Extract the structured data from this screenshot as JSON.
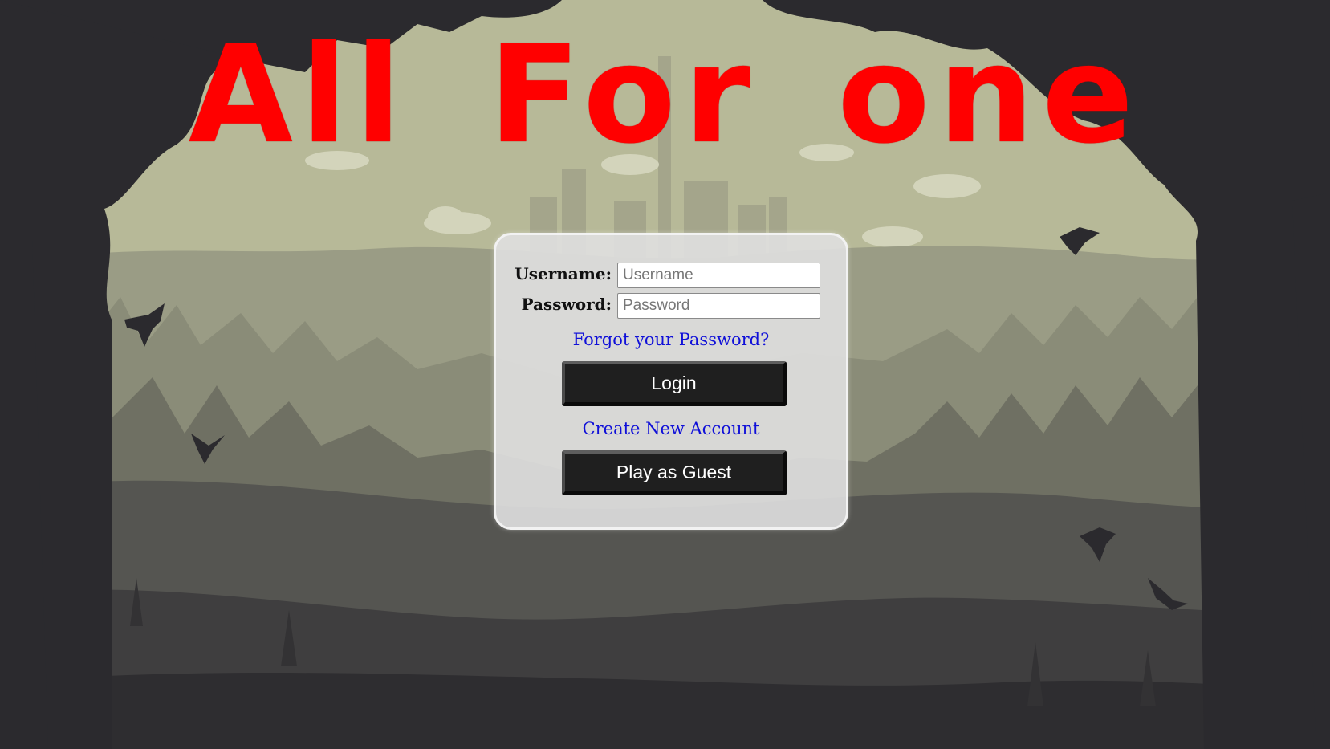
{
  "app": {
    "title": "All For one",
    "title_color": "#ff0000"
  },
  "login": {
    "username_label": "Username:",
    "username_placeholder": "Username",
    "username_value": "",
    "password_label": "Password:",
    "password_placeholder": "Password",
    "password_value": "",
    "forgot_link": "Forgot your Password?",
    "login_button": "Login",
    "create_account_link": "Create New Account",
    "guest_button": "Play as Guest"
  },
  "theme": {
    "link_color": "#1010d8",
    "button_color": "#1f1f1f",
    "panel_color": "#e0e0e0",
    "sky_color": "#b9bb9c",
    "foliage_color": "#2b2a2e"
  },
  "decor": {
    "icons": [
      "tree-canopy-left",
      "tree-canopy-right",
      "ruined-city-icon",
      "crow-icon",
      "cloud-icon",
      "pine-forest"
    ]
  }
}
